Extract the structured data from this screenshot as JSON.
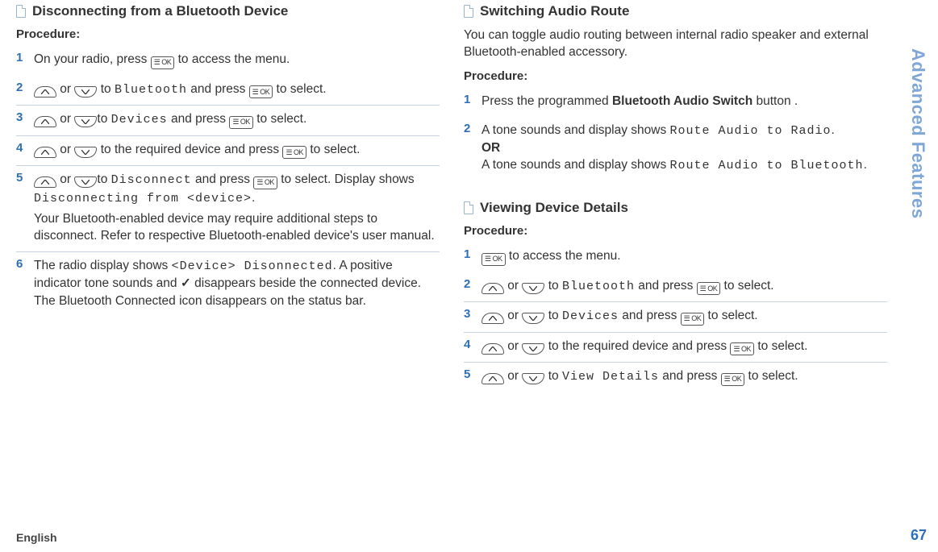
{
  "sidebar_text": "Advanced Features",
  "page_number": "67",
  "bottom_left": "English",
  "ok_label": "☰ OK",
  "left": {
    "title": "Disconnecting from a Bluetooth Device",
    "procedure": "Procedure:",
    "steps": {
      "s1": {
        "n": "1",
        "pre": "On your radio, press ",
        "post": " to access the menu."
      },
      "s2": {
        "n": "2",
        "pre": "",
        "or": " or ",
        "mid1": " to ",
        "code": "Bluetooth",
        "mid2": " and press ",
        "post": " to select."
      },
      "s3": {
        "n": "3",
        "pre": "",
        "or": " or ",
        "mid1": "to ",
        "code": "Devices",
        "mid2": " and press ",
        "post": " to select."
      },
      "s4": {
        "n": "4",
        "pre": "",
        "or": " or ",
        "mid1": " to the required device and press ",
        "post": " to select."
      },
      "s5": {
        "n": "5",
        "or": " or ",
        "mid1": "to ",
        "code": "Disconnect",
        "mid2": " and press ",
        "post": " to select. Display shows ",
        "code2": "Disconnecting from <device>",
        "tail": ".",
        "extra": "Your Bluetooth-enabled device may require additional steps to disconnect. Refer to respective Bluetooth-enabled device's user manual."
      },
      "s6": {
        "n": "6",
        "pre": "The radio display shows ",
        "code": "<Device> Disonnected",
        "mid": ". A positive indicator tone sounds and ",
        "check": "✓",
        "tail": " disappears beside the connected device. The Bluetooth Connected icon disappears on the status bar."
      }
    }
  },
  "right_a": {
    "title": "Switching Audio Route",
    "intro": "You can toggle audio routing between internal radio speaker and external Bluetooth-enabled accessory.",
    "procedure": "Procedure:",
    "steps": {
      "s1": {
        "n": "1",
        "text_pre": "Press the programmed ",
        "bold": "Bluetooth Audio Switch",
        "text_post": " button ."
      },
      "s2": {
        "n": "2",
        "l1a": "A tone sounds and display shows ",
        "code1": "Route Audio to Radio",
        "l1b": ".",
        "or": "OR",
        "l2a": "A tone sounds and display shows ",
        "code2": "Route Audio to Bluetooth",
        "l2b": "."
      }
    }
  },
  "right_b": {
    "title": "Viewing Device Details",
    "procedure": "Procedure:",
    "steps": {
      "s1": {
        "n": "1",
        "post": " to access the menu."
      },
      "s2": {
        "n": "2",
        "or": " or ",
        "mid1": " to ",
        "code": "Bluetooth",
        "mid2": " and press ",
        "post": " to select."
      },
      "s3": {
        "n": "3",
        "or": " or ",
        "mid1": " to ",
        "code": "Devices",
        "mid2": " and press ",
        "post": " to select."
      },
      "s4": {
        "n": "4",
        "or": " or ",
        "mid1": " to the required device and press ",
        "post": " to select."
      },
      "s5": {
        "n": "5",
        "or": " or ",
        "mid1": " to ",
        "code": "View Details",
        "mid2": " and press ",
        "post": " to select."
      }
    }
  }
}
